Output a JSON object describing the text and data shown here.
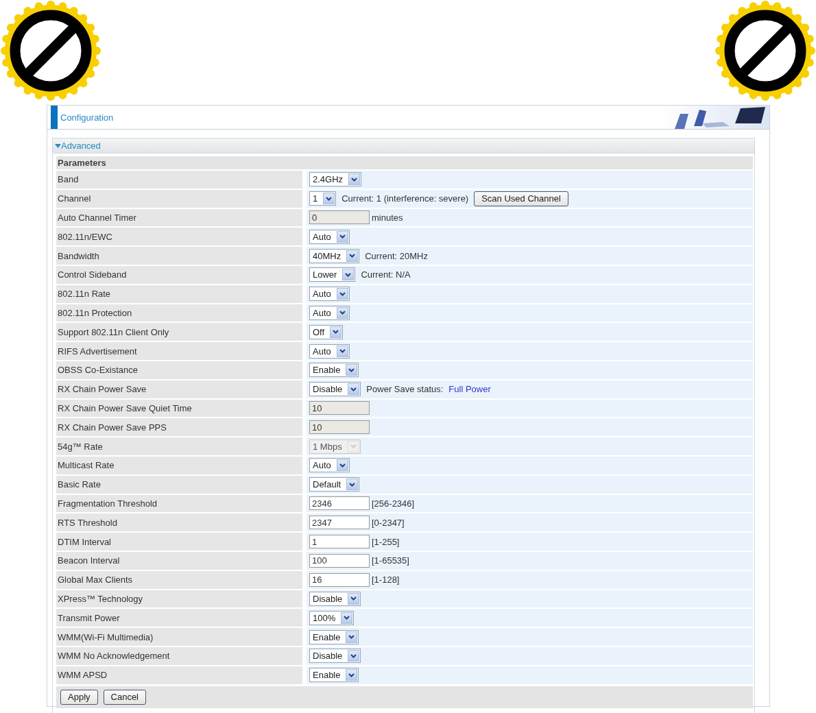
{
  "header": {
    "title": "Configuration"
  },
  "section": {
    "title": "Advanced",
    "expanded": true
  },
  "table": {
    "heading": "Parameters",
    "rows": [
      {
        "label": "Band",
        "controls": [
          {
            "kind": "select",
            "value": "2.4GHz",
            "disabled": false
          }
        ]
      },
      {
        "label": "Channel",
        "controls": [
          {
            "kind": "select",
            "value": "1",
            "disabled": false
          },
          {
            "kind": "text",
            "text": "Current: 1 (interference: severe)"
          },
          {
            "kind": "button",
            "text": "Scan Used Channel"
          }
        ]
      },
      {
        "label": "Auto Channel Timer",
        "controls": [
          {
            "kind": "input",
            "value": "0",
            "disabled": true
          },
          {
            "kind": "text",
            "text": "minutes"
          }
        ]
      },
      {
        "label": "802.11n/EWC",
        "controls": [
          {
            "kind": "select",
            "value": "Auto",
            "disabled": false
          }
        ]
      },
      {
        "label": "Bandwidth",
        "controls": [
          {
            "kind": "select",
            "value": "40MHz",
            "disabled": false
          },
          {
            "kind": "text",
            "text": "Current: 20MHz"
          }
        ]
      },
      {
        "label": "Control Sideband",
        "controls": [
          {
            "kind": "select",
            "value": "Lower",
            "disabled": false
          },
          {
            "kind": "text",
            "text": "Current: N/A"
          }
        ]
      },
      {
        "label": "802.11n Rate",
        "controls": [
          {
            "kind": "select",
            "value": "Auto",
            "disabled": false
          }
        ]
      },
      {
        "label": "802.11n Protection",
        "controls": [
          {
            "kind": "select",
            "value": "Auto",
            "disabled": false
          }
        ]
      },
      {
        "label": "Support 802.11n Client Only",
        "controls": [
          {
            "kind": "select",
            "value": "Off",
            "disabled": false
          }
        ]
      },
      {
        "label": "RIFS Advertisement",
        "controls": [
          {
            "kind": "select",
            "value": "Auto",
            "disabled": false
          }
        ]
      },
      {
        "label": "OBSS Co-Existance",
        "controls": [
          {
            "kind": "select",
            "value": "Enable",
            "disabled": false
          }
        ]
      },
      {
        "label": "RX Chain Power Save",
        "controls": [
          {
            "kind": "select",
            "value": "Disable",
            "disabled": false
          },
          {
            "kind": "text",
            "text": "Power Save status:"
          },
          {
            "kind": "status",
            "text": "Full Power"
          }
        ]
      },
      {
        "label": "RX Chain Power Save Quiet Time",
        "controls": [
          {
            "kind": "input",
            "value": "10",
            "disabled": true
          }
        ]
      },
      {
        "label": "RX Chain Power Save PPS",
        "controls": [
          {
            "kind": "input",
            "value": "10",
            "disabled": true
          }
        ]
      },
      {
        "label": "54g™ Rate",
        "controls": [
          {
            "kind": "select",
            "value": "1 Mbps",
            "disabled": true
          }
        ]
      },
      {
        "label": "Multicast Rate",
        "controls": [
          {
            "kind": "select",
            "value": "Auto",
            "disabled": false
          }
        ]
      },
      {
        "label": "Basic Rate",
        "controls": [
          {
            "kind": "select",
            "value": "Default",
            "disabled": false
          }
        ]
      },
      {
        "label": "Fragmentation Threshold",
        "controls": [
          {
            "kind": "input",
            "value": "2346",
            "disabled": false
          },
          {
            "kind": "text",
            "text": "[256-2346]"
          }
        ]
      },
      {
        "label": "RTS Threshold",
        "controls": [
          {
            "kind": "input",
            "value": "2347",
            "disabled": false
          },
          {
            "kind": "text",
            "text": "[0-2347]"
          }
        ]
      },
      {
        "label": "DTIM Interval",
        "controls": [
          {
            "kind": "input",
            "value": "1",
            "disabled": false
          },
          {
            "kind": "text",
            "text": "[1-255]"
          }
        ]
      },
      {
        "label": "Beacon Interval",
        "controls": [
          {
            "kind": "input",
            "value": "100",
            "disabled": false
          },
          {
            "kind": "text",
            "text": "[1-65535]"
          }
        ]
      },
      {
        "label": "Global Max Clients",
        "controls": [
          {
            "kind": "input",
            "value": "16",
            "disabled": false
          },
          {
            "kind": "text",
            "text": "[1-128]"
          }
        ]
      },
      {
        "label": "XPress™ Technology",
        "controls": [
          {
            "kind": "select",
            "value": "Disable",
            "disabled": false
          }
        ]
      },
      {
        "label": "Transmit Power",
        "controls": [
          {
            "kind": "select",
            "value": "100%",
            "disabled": false
          }
        ]
      },
      {
        "label": "WMM(Wi-Fi Multimedia)",
        "controls": [
          {
            "kind": "select",
            "value": "Enable",
            "disabled": false
          }
        ]
      },
      {
        "label": "WMM No Acknowledgement",
        "controls": [
          {
            "kind": "select",
            "value": "Disable",
            "disabled": false
          }
        ]
      },
      {
        "label": "WMM APSD",
        "controls": [
          {
            "kind": "select",
            "value": "Enable",
            "disabled": false
          }
        ]
      }
    ]
  },
  "buttons": [
    "Apply",
    "Cancel"
  ]
}
